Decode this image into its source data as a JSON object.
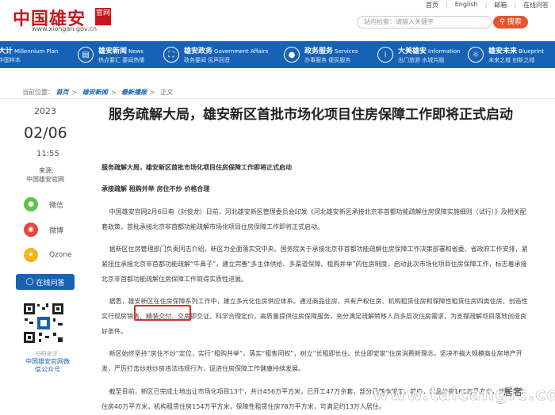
{
  "header": {
    "logo_text": "中国雄安",
    "logo_seal": "官网",
    "logo_url": "www.xiongan.gov.cn",
    "top_links": [
      "首页",
      "English",
      "邮箱",
      "在线问答"
    ],
    "search_placeholder": "站内检索：请输入关键字",
    "search_button": "搜索"
  },
  "nav": [
    {
      "title": "大计",
      "en": "Millennium Plan",
      "sub": "中国样本",
      "icon": "pen-icon"
    },
    {
      "title": "雄安新闻",
      "en": "News",
      "sub": "热点要汇  要闻热播",
      "icon": "news-icon"
    },
    {
      "title": "雄安政务",
      "en": "Government Affairs",
      "sub": "政务要闻  民声回音",
      "icon": "building-icon"
    },
    {
      "title": "政务服务",
      "en": "Services",
      "sub": "办事服务  便民服务",
      "icon": "person-icon"
    },
    {
      "title": "大美雄安",
      "en": "Information",
      "sub": "出门旅游  水城共融",
      "icon": "info-icon"
    },
    {
      "title": "雄安未来",
      "en": "Blueprint",
      "sub": "未来之城  创新之城",
      "icon": "bulb-icon"
    }
  ],
  "breadcrumb": {
    "label": "当前位置：",
    "items": [
      "首页",
      "雄安新闻",
      "最新播报"
    ],
    "current": "正文"
  },
  "meta": {
    "year": "2023",
    "date": "02/06",
    "time": "11:55",
    "source_label": "来源:",
    "source_value": "中国雄安官网"
  },
  "share": [
    {
      "label": "微信",
      "icon": "wechat-icon",
      "color": "#5ec14b"
    },
    {
      "label": "微博",
      "icon": "weibo-icon",
      "color": "#e8453c"
    },
    {
      "label": "Qzone",
      "icon": "qzone-icon",
      "color": "#f5b41a"
    }
  ],
  "ask_button": "在线问答",
  "qr_caption_1": "扫码关注",
  "qr_caption_2": "中国雄安官网微信公众号",
  "article": {
    "title": "服务疏解大局，雄安新区首批市场化项目住房保障工作即将正式启动",
    "lead": "服务疏解大局，雄安新区首批市场化项目住房保障工作即将正式启动",
    "subhead": "承接疏解  租购并举  房住不炒  价格合理",
    "p1": "中国雄安官网2月6日电（封俊龙）日前，河北雄安新区管理委员会印发《河北雄安新区承接北京非首都功能疏解住房保障实施细则（试行）》及相关配套政策，首批承接北京非首都功能疏解市场化项目住房保障工作即将正式启动。",
    "p2": "据新区住房管理部门负责同志介绍，新区为全面落实党中央、国务院关于承接北京非首都功能疏解住房保障工作决策部署和省委、省政府工作安排，紧紧扭住承接北京非首都功能疏解“牛鼻子”，建立完善“多主体供给、多渠道保障、租购并举”的住房制度，启动此次市场化项目住房保障工作，标志着承接北京非首都功能疏解住房保障工作取得实质性进展。",
    "p3": "据悉，雄安新区在住房保障系列工作中，建立多元化住房供应体系。通过商品住房、共有产权住房、机构租赁住房和保障性租赁住房四类住房，创造性实行现房销售、精装交付、交房即交证、科学合理定价，高质量提供住房保障服务，充分满足疏解转移人员多层次住房需求，为支撑疏解项目落地创造良好条件。",
    "p4": "新区始终坚持“房住不炒”定位，实行“租购并举”，落实“租售同权”，树立“长租即长住、长住即安家”住房消费新理念。坚决不搞大规模商业房地产开发，严厉打击炒地炒房违法违规行为，促进住房保障工作健康持续发展。",
    "p5": "截至目前，新区已完成土地出让市场化项目13个，共计456万平方米，已开工47万余套，部分已基本竣工。其中，商品住房166万平方米，共有产权住房40万平方米，机构租赁住房154万平方米，保障性租赁住房78万平方米，可满足约13万人居住。"
  },
  "watermark": "www.taicangfc.com",
  "watermark_2": "居者"
}
